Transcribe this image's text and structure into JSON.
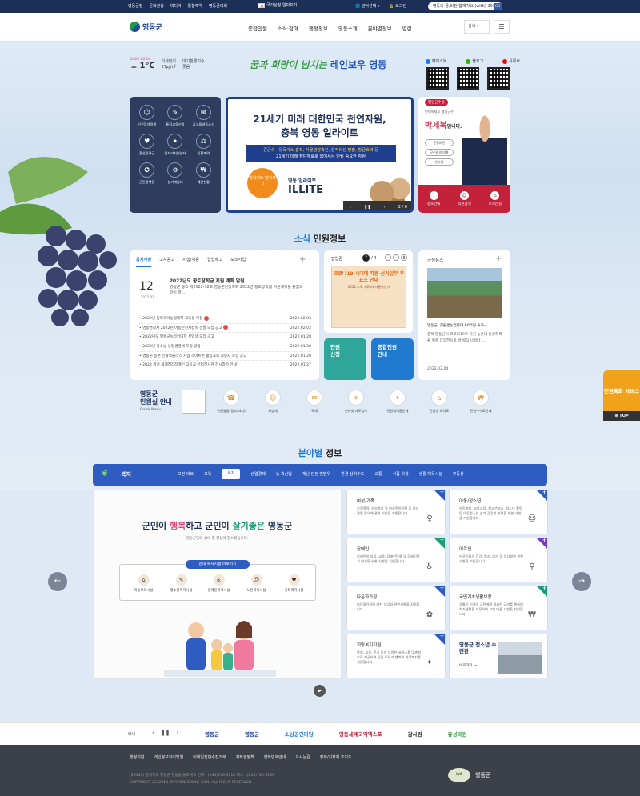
{
  "topbar": {
    "links": [
      "영동군청",
      "문화관광",
      "미디어",
      "통합예약",
      "영동군의회"
    ],
    "national": "국가상징 알아보기",
    "language": "언어선택",
    "login": "로그인",
    "slogan": "영동의 꿈,비전 함께가요 (with) 2030",
    "go": "GO"
  },
  "header": {
    "logo": "영동군",
    "gnb": [
      "종합민원",
      "소식·참여",
      "행정정보",
      "영동소개",
      "분야별정보",
      "열린"
    ],
    "search": "검색"
  },
  "weather": {
    "date": "2022.02.04",
    "temp": "1℃",
    "dust_label": "미세먼지",
    "dust_value": "27㎍/㎥",
    "air_label": "대기환경지수",
    "air_value": "좋음"
  },
  "slogan": {
    "main": "꿈과 희망이 넘치는",
    "brand": "레인보우 영동"
  },
  "sns": [
    {
      "label": "페이스북",
      "color": "#1877f2"
    },
    {
      "label": "블로그",
      "color": "#2db400"
    },
    {
      "label": "유튜브",
      "color": "#ff0000"
    }
  ],
  "quick": [
    {
      "label": "인구증가정책",
      "icon": "☺"
    },
    {
      "label": "통합교육신청",
      "icon": "✎"
    },
    {
      "label": "갑고을영동소식",
      "icon": "✉"
    },
    {
      "label": "출산장려금",
      "icon": "♥"
    },
    {
      "label": "일자리지원센터",
      "icon": "✦"
    },
    {
      "label": "입찰계약",
      "icon": "⚖"
    },
    {
      "label": "군민정책함",
      "icon": "✪"
    },
    {
      "label": "농기계임대",
      "icon": "⚙"
    },
    {
      "label": "예산현황",
      "icon": "₩"
    }
  ],
  "banner": {
    "title_l1": "21세기 미래 대한민국 천연자원,",
    "title_l2": "충북 영동 일라이트",
    "desc_l1": "중금속 · 유독가스 흡착, 식물생장촉진, 원적외선 방출, 항균효과 등",
    "desc_l2": "21세기 미래 첨단재료로 없어서는 안될 중요한 자원",
    "circle": "일라이트 알아보기",
    "brand_sub": "영동 일라이트",
    "brand": "ILLITE",
    "page": "2 / 6"
  },
  "mayor": {
    "tag": "열린군수실",
    "intro": "안녕하세요 영동군수",
    "name": "박세복",
    "suffix": "입니다.",
    "btns": [
      "군정비전",
      "군수와의 대화",
      "인사말"
    ],
    "links": [
      {
        "label": "정보안내",
        "icon": "i"
      },
      {
        "label": "직원검색",
        "icon": "☺"
      },
      {
        "label": "오시는길",
        "icon": "⌂"
      }
    ]
  },
  "news_title": {
    "a": "소식",
    "b": " 민원정보"
  },
  "notice": {
    "tabs": [
      "공지사항",
      "고시공고",
      "시험/채용",
      "입법예고",
      "보조사업"
    ],
    "feature": {
      "day": "12",
      "ym": "2022.01.",
      "title": "2022년도 향토장학금 지원 계획 알림",
      "desc": "영동군 공고 제2022-38호 영동군민장학회 2022년 향토장학금 지원계획을 붙임과 같이 알..."
    },
    "items": [
      {
        "title": "2022년 충북육아농업대학 교육생 모집",
        "date": "2022.02.03",
        "new": true
      },
      {
        "title": "영동경찰서 2022년 아동안전지킴이 선발 모집 공고",
        "date": "2022.02.02",
        "new": true
      },
      {
        "title": "2022년도 영동군농업인대학 신입생 모집 공고",
        "date": "2022.01.28",
        "new": false
      },
      {
        "title": "2022년 강소농 농업경영체 모집 알림",
        "date": "2022.01.28",
        "new": false
      },
      {
        "title": "영동군 농촌 신활력플러스 사업 스마트폰 활용교육 희망자 모집 공고",
        "date": "2022.01.28",
        "new": false
      },
      {
        "title": "2022 피선 세계청각장애인 고등교 산업전시관 전시참가 안내",
        "date": "2022.01.27",
        "new": false
      }
    ]
  },
  "popup": {
    "title": "팝업존",
    "current": "2",
    "total": "/ 4",
    "img_title": "코로나19 시대에 따른 선거업무 투표소 안내",
    "img_sub": "2022.3.9. 제20대 대통령선거"
  },
  "minwon": [
    {
      "label": "민원\n신청",
      "color": "#2ea79a"
    },
    {
      "label": "종합민원\n안내",
      "color": "#1f7ad0"
    }
  ],
  "gov_news": {
    "title": "군정뉴스",
    "headline": "영동군, 친환경농업분야 60억원 투자~",
    "desc": "충북 영동군이 코로나19로 지친 농촌의 일상회복을 위해 다양한으로 발 벗고 나섰다. ...",
    "date": "2022.02.04"
  },
  "quick_menu": {
    "title_l1": "영동군",
    "title_l2": "민원실 안내",
    "sub": "Quick Menu",
    "items": [
      {
        "label": "민원발급(정부24시)",
        "icon": "☎"
      },
      {
        "label": "지방세",
        "icon": "☺"
      },
      {
        "label": "국세",
        "icon": "✉"
      },
      {
        "label": "인터넷 지로납부",
        "icon": "☀"
      },
      {
        "label": "민원실이용안내",
        "icon": "✦"
      },
      {
        "label": "민원실 배치도",
        "icon": "⌂"
      },
      {
        "label": "민원수수료안내",
        "icon": "₩"
      }
    ]
  },
  "field_title": {
    "a": "분야별",
    "b": " 정보"
  },
  "field_tabs": {
    "current": "복지",
    "tabs": [
      "보건·의료",
      "교육",
      "복지",
      "산업경제",
      "농·축산업",
      "재난·안전·민방위",
      "환경·상하수도",
      "교통",
      "식품·위생",
      "생활·체육시설",
      "부동산"
    ],
    "active": 2
  },
  "field_main": {
    "h_a": "군민이 ",
    "h_b": "행복",
    "h_c": "하고 군민이 ",
    "h_d": "살기좋은",
    "h_e": " 영동군",
    "sub": "영동군민의 삶의 질 향상에 힘쓰겠습니다.",
    "box_label": "관내 복지시설 바로가기",
    "items": [
      {
        "label": "아동보육시설",
        "icon": "⌂"
      },
      {
        "label": "청소년복지시설",
        "icon": "✎"
      },
      {
        "label": "장애인복지시설",
        "icon": "♿"
      },
      {
        "label": "노인복지시설",
        "icon": "☺"
      },
      {
        "label": "기타복지시설",
        "icon": "♥"
      }
    ]
  },
  "field_cards": [
    {
      "title": "여성/가족",
      "desc": "가정폭력, 여성복지 및 여성주의정책 등 여성관련 중요에 관한 사항을 지원합니다.",
      "icon": "♀",
      "color": "#2f5cc0"
    },
    {
      "title": "아동/청소년",
      "desc": "아동복지, 보육사업, 청소년보호, 청소년 활동 등 아동청소년 삶과 건강한 발전을 위한 사항을 지원합니다.",
      "icon": "☺",
      "color": "#2f5cc0"
    },
    {
      "title": "장애인",
      "desc": "장애인의 의료, 교육, 장애인등록 및 장애인복지 향상을 위한 사항을 지원합니다.",
      "icon": "♿",
      "color": "#1a9e7a"
    },
    {
      "title": "어르신",
      "desc": "어르신들의 건강, 복지, 여가 및 일상회복 위한 사항을 지원합니다.",
      "icon": "⚲",
      "color": "#7a3cc0"
    },
    {
      "title": "다문화가정",
      "desc": "다문화가정에 대한 상담과 관련사항을 지원합니다.",
      "icon": "✿",
      "color": "#2f5cc0"
    },
    {
      "title": "국민기초생활보장",
      "desc": "생활이 어려운 군민에게 필요한 급여를 행하여 최저생활을 보장하여 그에 따른 사항을 지원합니다.",
      "icon": "₩",
      "color": "#1a9e7a"
    },
    {
      "title": "희망복지지원",
      "desc": "복지, 교육, 주거 등의 다양한 서비스를 맞춤형으로 제공하여 군민 모두가 행복한 희망복지를 지원합니다.",
      "icon": "✦",
      "color": "#2f5cc0"
    }
  ],
  "youth": {
    "title": "영동군 청소년 수련관",
    "more": "바로가기"
  },
  "float": {
    "label": "민원톡화 서비스",
    "top": "TOP"
  },
  "banners": {
    "label": "배너",
    "items": [
      {
        "label": "영동군",
        "color": "#1b3f8c"
      },
      {
        "label": "영동군",
        "color": "#1b3f8c"
      },
      {
        "label": "소상공인마당",
        "color": "#1f7ad0"
      },
      {
        "label": "영동세계국악엑스포",
        "color": "#c4213b"
      },
      {
        "label": "감사원",
        "color": "#222"
      },
      {
        "label": "유성과원",
        "color": "#3a9e45"
      }
    ]
  },
  "footer": {
    "links": [
      "행정지원",
      "개인정보처리방침",
      "이메일집단수집거부",
      "저작권정책",
      "전화번호안내",
      "오시는길",
      "정부/지자체 조직도"
    ],
    "address": "(29140) 충청북도 영동군 영동읍 돌고개 1   전화 : (043)740-3114   팩스 : (043)740-3139",
    "copyright": "COPYRIGHT (C) 2018 BY YEONGDONG-GUN. ALL RIGHT RESERVED.",
    "cert": "WA",
    "logo": "영동군"
  }
}
